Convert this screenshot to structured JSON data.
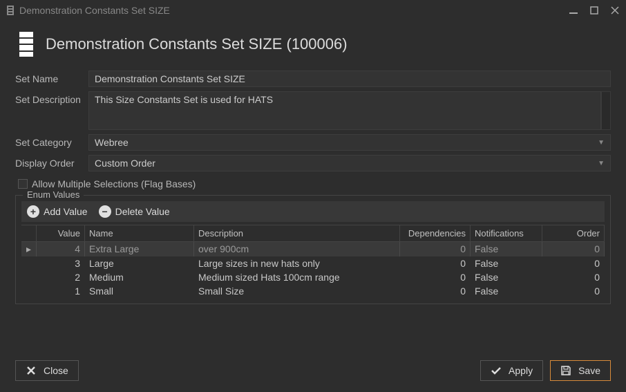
{
  "window": {
    "title": "Demonstration Constants Set SIZE"
  },
  "header": {
    "title": "Demonstration Constants Set SIZE (100006)"
  },
  "form": {
    "set_name_label": "Set Name",
    "set_name": "Demonstration Constants Set SIZE",
    "set_desc_label": "Set Description",
    "set_desc": "This Size Constants Set is used for HATS",
    "set_cat_label": "Set Category",
    "set_cat": "Webree",
    "display_order_label": "Display Order",
    "display_order": "Custom Order",
    "allow_multi_label": "Allow Multiple Selections (Flag Bases)"
  },
  "enum": {
    "group_title": "Enum Values",
    "add_label": "Add Value",
    "delete_label": "Delete Value",
    "columns": {
      "value": "Value",
      "name": "Name",
      "description": "Description",
      "dependencies": "Dependencies",
      "notifications": "Notifications",
      "order": "Order"
    },
    "rows": [
      {
        "value": "4",
        "name": "Extra Large",
        "description": "over 900cm",
        "dependencies": "0",
        "notifications": "False",
        "order": "0"
      },
      {
        "value": "3",
        "name": "Large",
        "description": "Large sizes in new hats only",
        "dependencies": "0",
        "notifications": "False",
        "order": "0"
      },
      {
        "value": "2",
        "name": "Medium",
        "description": "Medium sized Hats 100cm range",
        "dependencies": "0",
        "notifications": "False",
        "order": "0"
      },
      {
        "value": "1",
        "name": "Small",
        "description": "Small Size",
        "dependencies": "0",
        "notifications": "False",
        "order": "0"
      }
    ]
  },
  "footer": {
    "close": "Close",
    "apply": "Apply",
    "save": "Save"
  }
}
